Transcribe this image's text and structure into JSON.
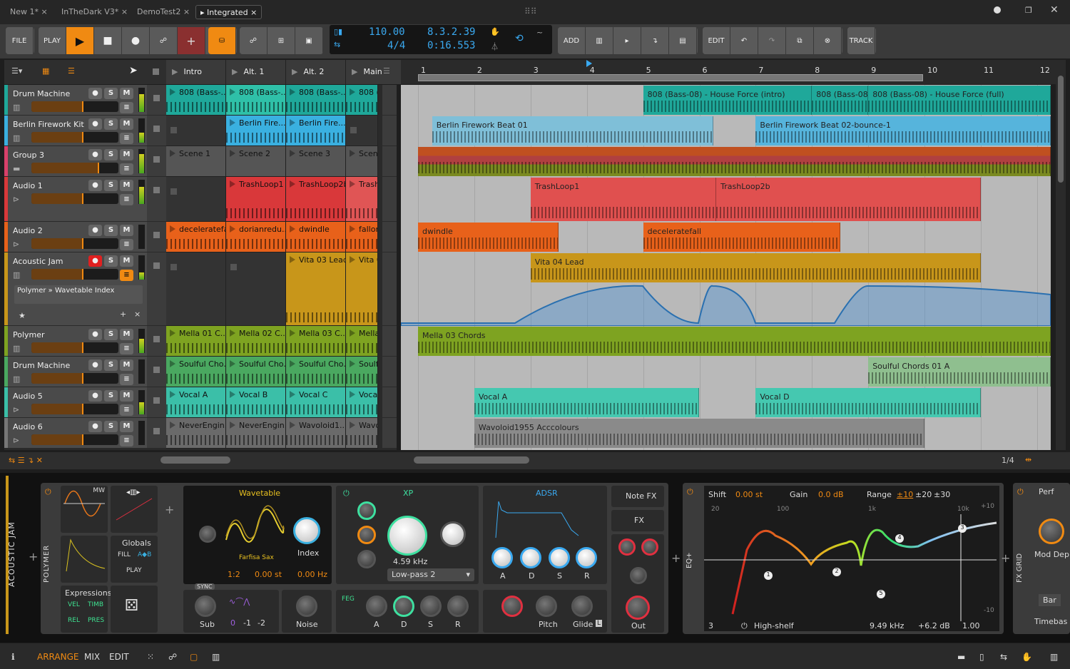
{
  "window": {
    "tabs": [
      {
        "label": "New 1*"
      },
      {
        "label": "InTheDark V3*"
      },
      {
        "label": "DemoTest2"
      },
      {
        "label": "Integrated",
        "active": true
      }
    ],
    "close_icon": "×"
  },
  "toolbar": {
    "file": "FILE",
    "play": "PLAY",
    "add": "ADD",
    "edit": "EDIT",
    "track": "TRACK"
  },
  "transport": {
    "tempo": "110.00",
    "time_signature": "4/4",
    "position_bars": "8.3.2.39",
    "position_time": "0:16.553"
  },
  "scenes": [
    "Intro",
    "Alt. 1",
    "Alt. 2",
    "Main"
  ],
  "ruler": {
    "bars": [
      "1",
      "2",
      "3",
      "4",
      "5",
      "6",
      "7",
      "8",
      "9",
      "10",
      "11",
      "12"
    ],
    "playhead_bar": 4
  },
  "colors": {
    "accent": "#f08a12",
    "lcd": "#3aa9f0"
  },
  "tracks": [
    {
      "name": "Drum Machine",
      "color": "#1fa89a",
      "icon": "drum-icon",
      "volume": 0.6,
      "meter": 0.75,
      "cells": [
        {
          "name": "808 (Bass-...",
          "color": "#1fa89a"
        },
        {
          "name": "808 (Bass-...",
          "color": "#2fc0a8"
        },
        {
          "name": "808 (Bass-...",
          "color": "#1fa89a"
        },
        {
          "name": "808 (Bass-...",
          "color": "#1fa89a"
        }
      ],
      "clips": [
        {
          "name": "808 (Bass-08) - House Force (intro)",
          "start": 5,
          "end": 8,
          "color": "#1fa89a"
        },
        {
          "name": "808 (Bass-08)",
          "start": 8,
          "end": 9,
          "color": "#1fa89a"
        },
        {
          "name": "808 (Bass-08) - House Force (full)",
          "start": 9,
          "end": 12.25,
          "color": "#1fa89a"
        }
      ]
    },
    {
      "name": "Berlin Firework Kit",
      "color": "#3ab0e0",
      "icon": "drum-icon",
      "volume": 0.6,
      "meter": 0.4,
      "cells": [
        null,
        {
          "name": "Berlin Fire...",
          "color": "#3ab0e0"
        },
        {
          "name": "Berlin Fire...",
          "color": "#3ab0e0"
        },
        null
      ],
      "clips": [
        {
          "name": "Berlin Firework Beat 01",
          "start": 1.25,
          "end": 6.25,
          "color": "#7fbfd8"
        },
        {
          "name": "Berlin Firework Beat 02-bounce-1",
          "start": 7,
          "end": 12.25,
          "color": "#56b4dc"
        }
      ]
    },
    {
      "name": "Group 3",
      "color": "#d8406a",
      "icon": "folder-icon",
      "volume": 0.78,
      "meter": 0.8,
      "cells": [
        {
          "name": "Scene 1",
          "color": "#555"
        },
        {
          "name": "Scene 2",
          "color": "#555"
        },
        {
          "name": "Scene 3",
          "color": "#555"
        },
        {
          "name": "Scene",
          "color": "#555"
        }
      ],
      "clips": [
        {
          "name": "",
          "start": 1,
          "end": 12.25,
          "color": "#7a6a30"
        }
      ]
    },
    {
      "name": "Audio 1",
      "color": "#d9383a",
      "icon": "audio-icon",
      "volume": 0.6,
      "meter": 0.7,
      "tall": true,
      "cells": [
        null,
        {
          "name": "TrashLoop1",
          "color": "#d9383a"
        },
        {
          "name": "TrashLoop2b",
          "color": "#d9383a"
        },
        {
          "name": "Trash",
          "color": "#e05555"
        }
      ],
      "clips": [
        {
          "name": "TrashLoop1",
          "start": 3,
          "end": 6.3,
          "color": "#e0504f"
        },
        {
          "name": "TrashLoop2b",
          "start": 6.3,
          "end": 11,
          "color": "#e0504f"
        }
      ]
    },
    {
      "name": "Audio 2",
      "color": "#e8611a",
      "icon": "audio-icon",
      "volume": 0.6,
      "meter": 0,
      "cells": [
        {
          "name": "deceleratefall",
          "color": "#e8611a"
        },
        {
          "name": "dorianredu...",
          "color": "#e8611a"
        },
        {
          "name": "dwindle",
          "color": "#e8611a"
        },
        {
          "name": "fallon",
          "color": "#e8611a"
        }
      ],
      "clips": [
        {
          "name": "dwindle",
          "start": 1,
          "end": 3.5,
          "color": "#e8611a"
        },
        {
          "name": "deceleratefall",
          "start": 5,
          "end": 8.5,
          "color": "#e8611a"
        }
      ]
    },
    {
      "name": "Acoustic Jam",
      "color": "#c8961a",
      "icon": "piano-icon",
      "volume": 0.6,
      "meter": 0.3,
      "armed": true,
      "automation": "Polymer » Wavetable Index",
      "cells": [
        null,
        null,
        {
          "name": "Vita 03 Lead",
          "color": "#c8961a"
        },
        {
          "name": "Vita 0",
          "color": "#c8961a"
        }
      ],
      "clips": [
        {
          "name": "Vita 04 Lead",
          "start": 3,
          "end": 11,
          "color": "#c8961a"
        }
      ]
    },
    {
      "name": "Polymer",
      "color": "#7ea321",
      "icon": "piano-icon",
      "volume": 0.6,
      "meter": 0.6,
      "cells": [
        {
          "name": "Mella 01 C...",
          "color": "#7ea321"
        },
        {
          "name": "Mella 02 C...",
          "color": "#7ea321"
        },
        {
          "name": "Mella 03 C...",
          "color": "#7ea321"
        },
        {
          "name": "Mella",
          "color": "#7ea321"
        }
      ],
      "clips": [
        {
          "name": "Mella 03 Chords",
          "start": 1,
          "end": 12.25,
          "color": "#7ea321"
        }
      ]
    },
    {
      "name": "Drum Machine",
      "color": "#4aa860",
      "icon": "drum-icon",
      "volume": 0.6,
      "meter": 0,
      "cells": [
        {
          "name": "Soulful Cho...",
          "color": "#4aa860"
        },
        {
          "name": "Soulful Cho...",
          "color": "#4aa860"
        },
        {
          "name": "Soulful Cho...",
          "color": "#4aa860"
        },
        {
          "name": "Soulfu",
          "color": "#4aa860"
        }
      ],
      "clips": [
        {
          "name": "Soulful Chords 01 A",
          "start": 9,
          "end": 12.25,
          "color": "#8fbf8f"
        }
      ]
    },
    {
      "name": "Audio 5",
      "color": "#3bbfa8",
      "icon": "audio-icon",
      "volume": 0.6,
      "meter": 0.5,
      "cells": [
        {
          "name": "Vocal A",
          "color": "#3bbfa8"
        },
        {
          "name": "Vocal B",
          "color": "#3bbfa8"
        },
        {
          "name": "Vocal C",
          "color": "#3bbfa8"
        },
        {
          "name": "Vocal",
          "color": "#3bbfa8"
        }
      ],
      "clips": [
        {
          "name": "Vocal A",
          "start": 2,
          "end": 6,
          "color": "#45c8b0"
        },
        {
          "name": "Vocal D",
          "start": 7,
          "end": 11,
          "color": "#45c8b0"
        }
      ]
    },
    {
      "name": "Audio 6",
      "color": "#777",
      "icon": "audio-icon",
      "volume": 0.6,
      "meter": 0,
      "cells": [
        {
          "name": "NeverEngin...",
          "color": "#6a6a6a"
        },
        {
          "name": "NeverEngin...",
          "color": "#6a6a6a"
        },
        {
          "name": "Wavoloid1...",
          "color": "#6a6a6a"
        },
        {
          "name": "Wavo",
          "color": "#6a6a6a"
        }
      ],
      "clips": [
        {
          "name": "Wavoloid1955 Acccolours",
          "start": 2,
          "end": 10,
          "color": "#8a8a8a"
        }
      ]
    }
  ],
  "zoom": "1/4",
  "device": {
    "track_label": "ACOUSTIC JAM",
    "polymer_label": "POLYMER",
    "mw": "MW",
    "globals": "Globals",
    "fill": "FILL",
    "ab": "A◆B",
    "play": "PLAY",
    "expressions": "Expressions",
    "vel": "VEL",
    "timb": "TIMB",
    "rel": "REL",
    "pres": "PRES",
    "osc": {
      "type": "Wavetable",
      "table": "Farfisa Sax",
      "index": "Index",
      "ratio": "1:2",
      "pitch": "0.00 st",
      "detune": "0.00 Hz",
      "sync": "SYNC",
      "index_value": 0.55
    },
    "sub": {
      "label": "Sub",
      "octaves": [
        "0",
        "-1",
        "-2"
      ]
    },
    "noise": "Noise",
    "filter": {
      "type": "XP",
      "freq": "4.59 kHz",
      "mode": "Low-pass 2"
    },
    "feg": {
      "label": "FEG",
      "knobs": [
        "A",
        "D",
        "S",
        "R"
      ]
    },
    "adsr": {
      "label": "ADSR",
      "knobs": [
        "A",
        "D",
        "S",
        "R"
      ]
    },
    "voice": {
      "pitch": "Pitch",
      "glide": "Glide",
      "glide_badge": "L"
    },
    "notefx": "Note FX",
    "fx": "FX",
    "out": "Out",
    "eq": {
      "name": "EQ+",
      "shift_label": "Shift",
      "shift": "0.00 st",
      "gain_label": "Gain",
      "gain": "0.0 dB",
      "range_label": "Range",
      "ranges": [
        "±10",
        "±20",
        "±30"
      ],
      "freq_ticks": [
        "20",
        "100",
        "1k",
        "10k"
      ],
      "db_ticks": [
        "+10",
        "-10"
      ],
      "band_number": "3",
      "band_type": "High-shelf",
      "band_freq": "9.49 kHz",
      "band_gain": "+6.2 dB",
      "band_q": "1.00",
      "bands": [
        "1",
        "2",
        "3",
        "4",
        "5"
      ]
    },
    "fxgrid": {
      "name": "FX GRID",
      "perf": "Perf",
      "mod": "Mod Dep",
      "bar": "Bar",
      "timebase": "Timebas"
    }
  },
  "statusbar": {
    "arrange": "ARRANGE",
    "mix": "MIX",
    "edit": "EDIT"
  }
}
